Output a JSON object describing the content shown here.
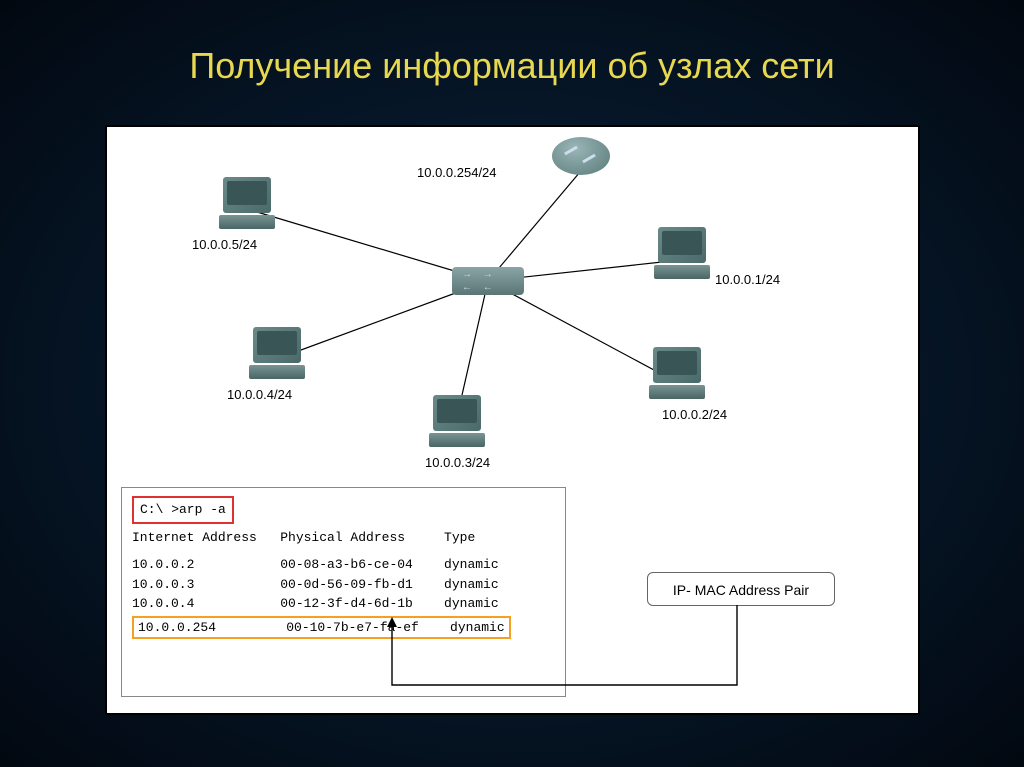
{
  "title": "Получение информации об узлах сети",
  "diagram": {
    "router_label": "10.0.0.254/24",
    "hosts": {
      "pc1": "10.0.0.1/24",
      "pc2": "10.0.0.2/24",
      "pc3": "10.0.0.3/24",
      "pc4": "10.0.0.4/24",
      "pc5": "10.0.0.5/24"
    }
  },
  "terminal": {
    "command": "C:\\ >arp -a",
    "header": "Internet Address   Physical Address     Type",
    "rows": [
      {
        "ip": "10.0.0.2",
        "mac": "00-08-a3-b6-ce-04",
        "type": "dynamic"
      },
      {
        "ip": "10.0.0.3",
        "mac": "00-0d-56-09-fb-d1",
        "type": "dynamic"
      },
      {
        "ip": "10.0.0.4",
        "mac": "00-12-3f-d4-6d-1b",
        "type": "dynamic"
      },
      {
        "ip": "10.0.0.254",
        "mac": "00-10-7b-e7-fa-ef",
        "type": "dynamic"
      }
    ],
    "row_lines": {
      "r0": "10.0.0.2           00-08-a3-b6-ce-04    dynamic",
      "r1": "10.0.0.3           00-0d-56-09-fb-d1    dynamic",
      "r2": "10.0.0.4           00-12-3f-d4-6d-1b    dynamic",
      "r3": "10.0.0.254         00-10-7b-e7-fa-ef    dynamic"
    }
  },
  "callout": {
    "pair_label": "IP- MAC Address Pair"
  }
}
